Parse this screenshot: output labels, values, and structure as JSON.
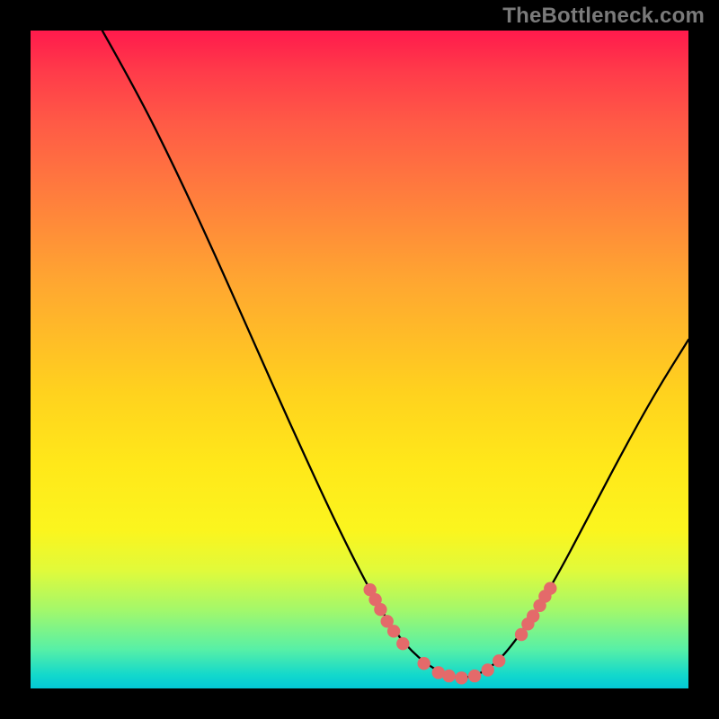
{
  "watermark": "TheBottleneck.com",
  "chart_data": {
    "type": "line",
    "title": "",
    "xlabel": "",
    "ylabel": "",
    "xlim": [
      0,
      100
    ],
    "ylim": [
      0,
      100
    ],
    "series": [
      {
        "name": "curve",
        "points": [
          {
            "x": 10.9,
            "y": 100.0
          },
          {
            "x": 16.0,
            "y": 91.0
          },
          {
            "x": 22.0,
            "y": 79.0
          },
          {
            "x": 28.0,
            "y": 66.0
          },
          {
            "x": 34.0,
            "y": 52.5
          },
          {
            "x": 40.0,
            "y": 39.0
          },
          {
            "x": 46.0,
            "y": 26.0
          },
          {
            "x": 51.0,
            "y": 16.0
          },
          {
            "x": 55.0,
            "y": 9.0
          },
          {
            "x": 59.0,
            "y": 4.5
          },
          {
            "x": 63.0,
            "y": 2.0
          },
          {
            "x": 66.0,
            "y": 1.5
          },
          {
            "x": 69.0,
            "y": 2.5
          },
          {
            "x": 72.0,
            "y": 5.0
          },
          {
            "x": 76.0,
            "y": 10.5
          },
          {
            "x": 80.0,
            "y": 17.0
          },
          {
            "x": 85.0,
            "y": 26.5
          },
          {
            "x": 90.0,
            "y": 36.0
          },
          {
            "x": 95.0,
            "y": 45.0
          },
          {
            "x": 100.0,
            "y": 53.0
          }
        ]
      },
      {
        "name": "dots",
        "points": [
          {
            "x": 51.6,
            "y": 15.0
          },
          {
            "x": 52.4,
            "y": 13.5
          },
          {
            "x": 53.2,
            "y": 12.0
          },
          {
            "x": 54.2,
            "y": 10.2
          },
          {
            "x": 55.2,
            "y": 8.7
          },
          {
            "x": 56.6,
            "y": 6.8
          },
          {
            "x": 59.8,
            "y": 3.8
          },
          {
            "x": 62.0,
            "y": 2.4
          },
          {
            "x": 63.6,
            "y": 1.9
          },
          {
            "x": 65.5,
            "y": 1.6
          },
          {
            "x": 67.5,
            "y": 1.9
          },
          {
            "x": 69.5,
            "y": 2.8
          },
          {
            "x": 71.2,
            "y": 4.2
          },
          {
            "x": 74.6,
            "y": 8.2
          },
          {
            "x": 75.6,
            "y": 9.8
          },
          {
            "x": 76.4,
            "y": 11.0
          },
          {
            "x": 77.4,
            "y": 12.6
          },
          {
            "x": 78.2,
            "y": 14.0
          },
          {
            "x": 79.0,
            "y": 15.2
          }
        ]
      }
    ]
  }
}
